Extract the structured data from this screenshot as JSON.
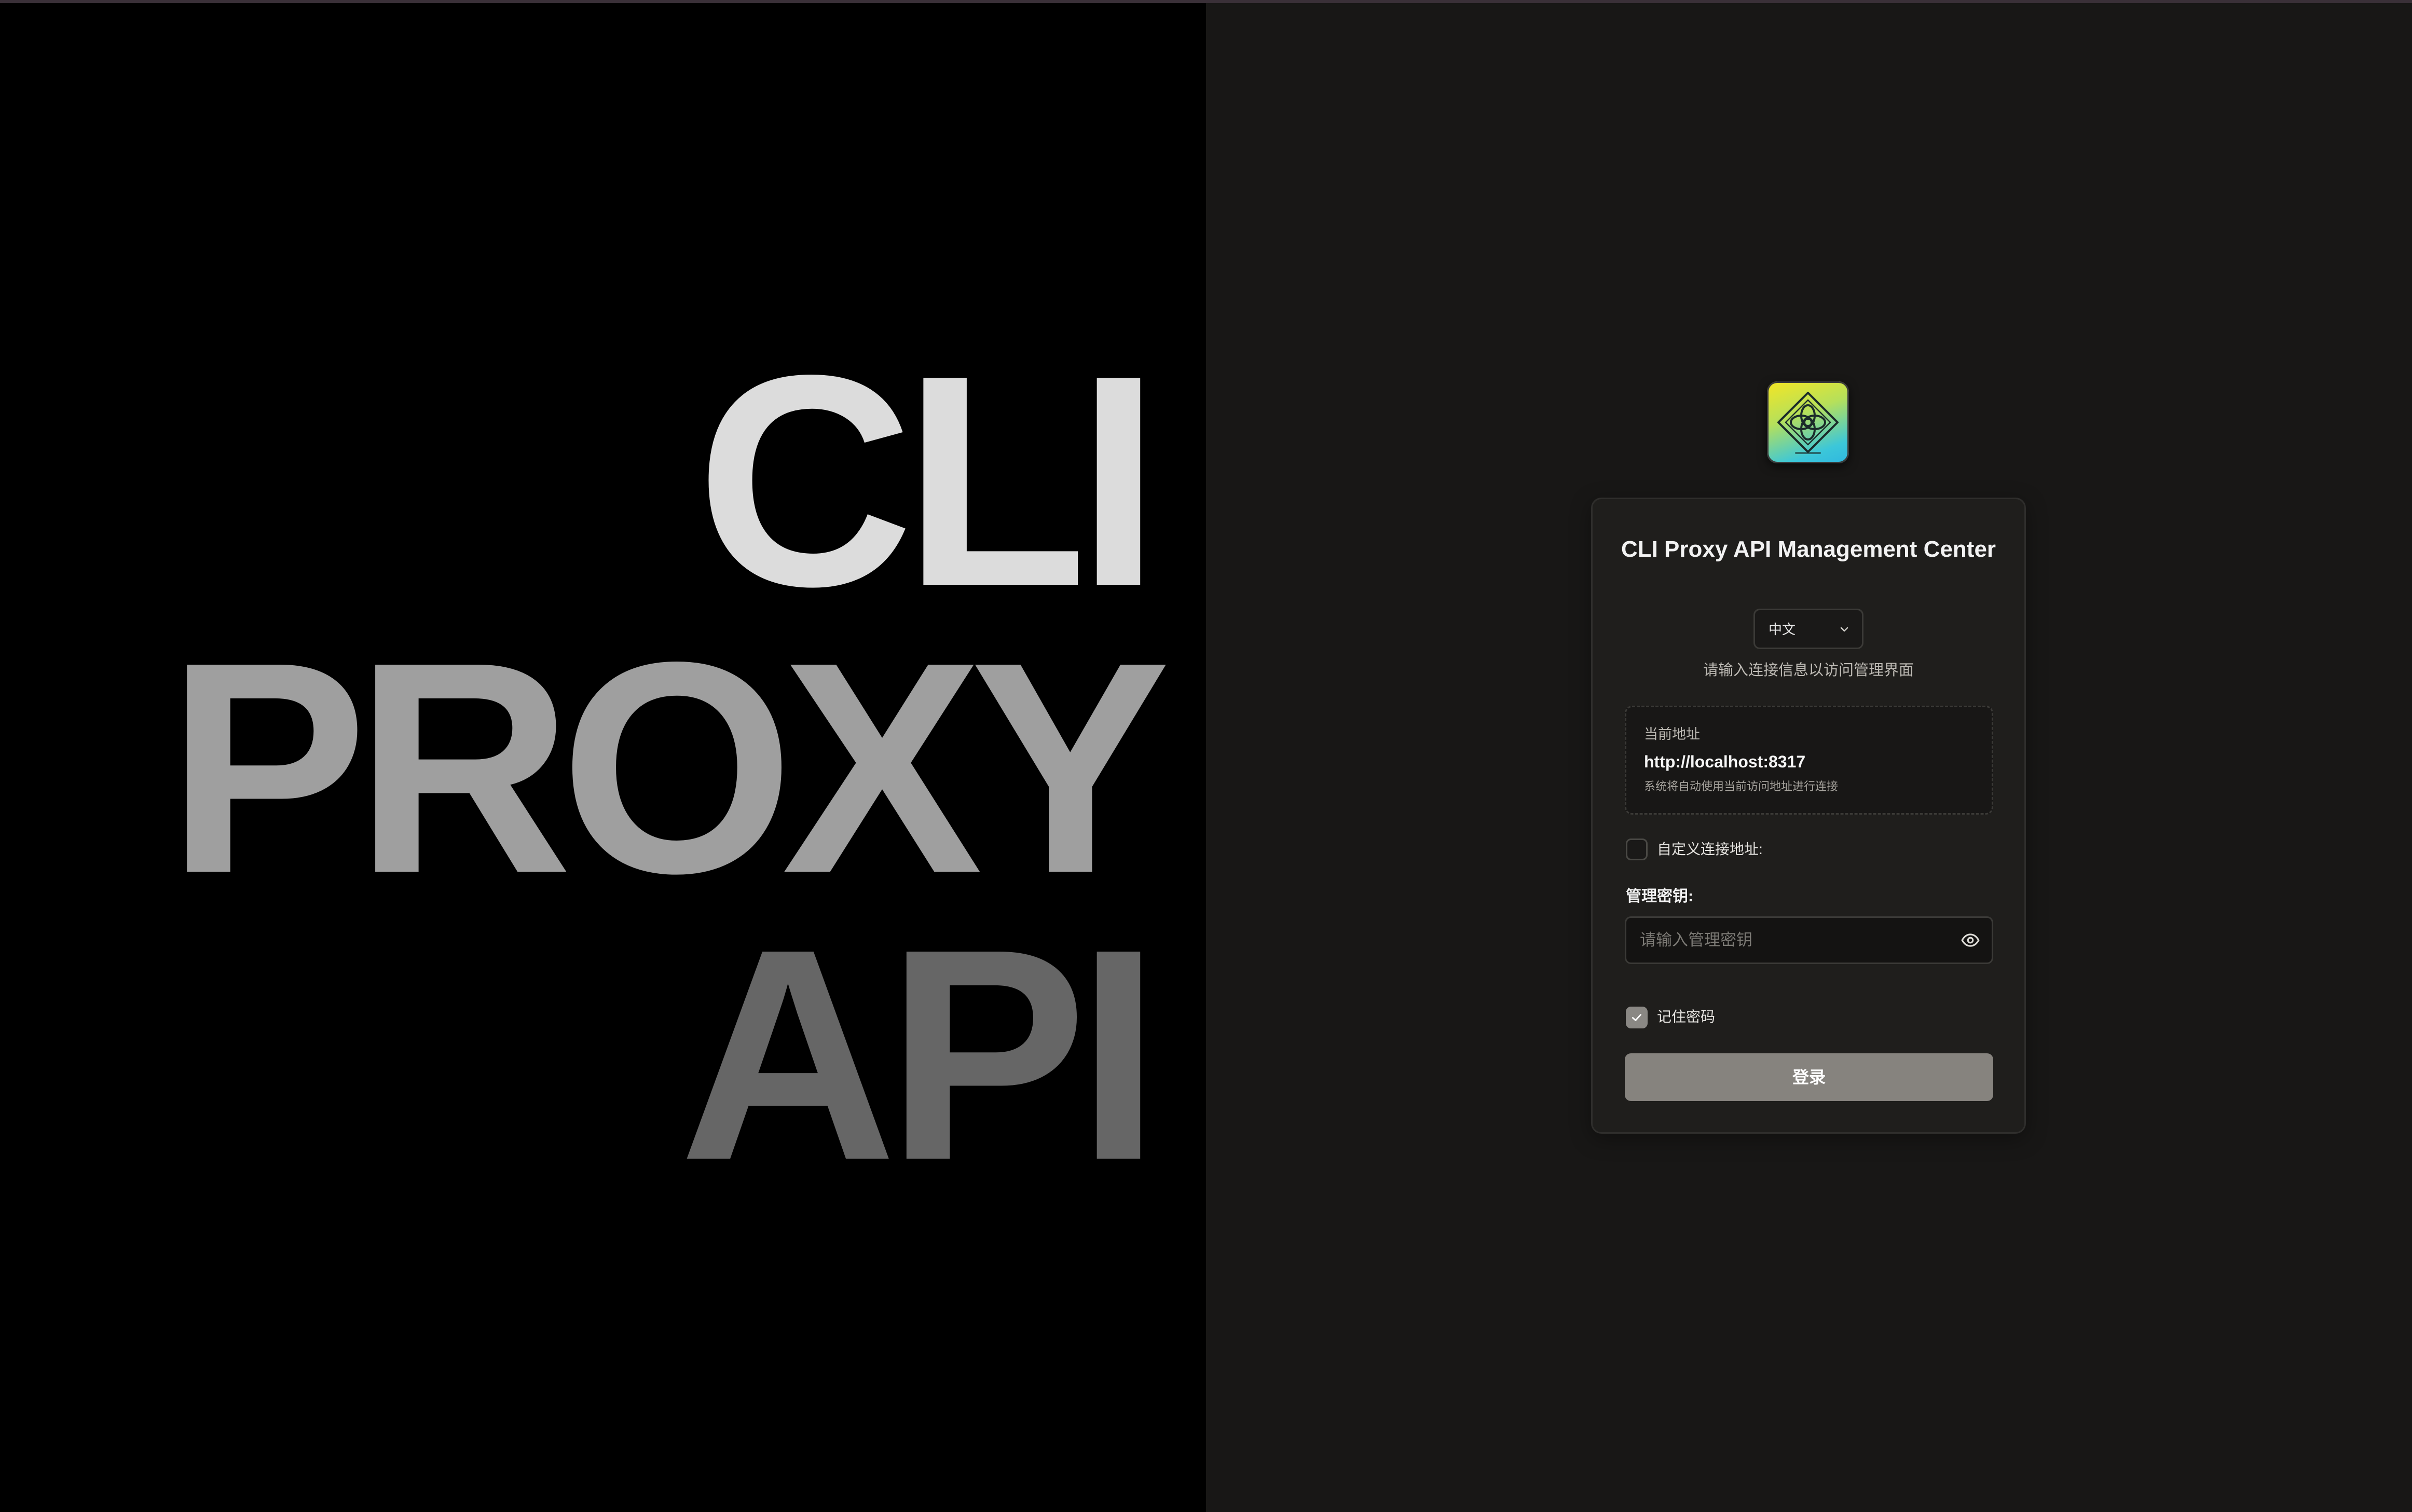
{
  "hero": {
    "line1": "CLI",
    "line2": "PROXY",
    "line3": "API"
  },
  "logo": {
    "icon": "diamond-knot-logo-icon"
  },
  "login": {
    "title": "CLI Proxy API Management Center",
    "language": "中文",
    "subtitle": "请输入连接信息以访问管理界面",
    "current_address_label": "当前地址",
    "current_address": "http://localhost:8317",
    "address_hint": "系统将自动使用当前访问地址进行连接",
    "custom_address_label": "自定义连接地址:",
    "custom_address_checked": false,
    "key_label": "管理密钥:",
    "key_placeholder": "请输入管理密钥",
    "remember_label": "记住密码",
    "remember_checked": true,
    "submit_label": "登录"
  },
  "colors": {
    "hero_background": "#000000",
    "panel_background": "#181716",
    "card_background": "#1f1e1c",
    "button_background": "#86837e",
    "cli_text": "#dcdcdc",
    "proxy_text": "#9f9f9f",
    "api_text": "#666666"
  }
}
